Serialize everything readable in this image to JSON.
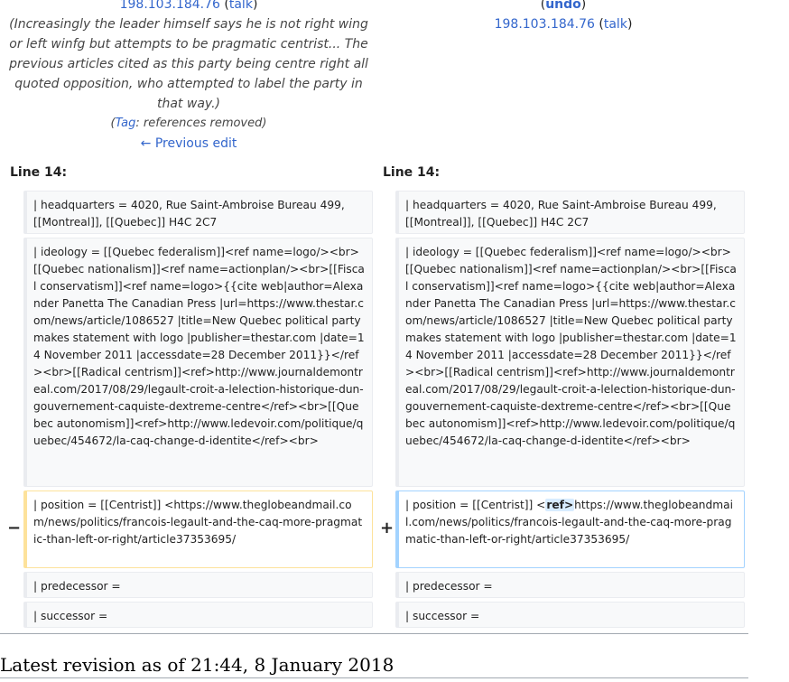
{
  "left_header": {
    "ip": "198.103.184.76",
    "talk": "talk",
    "comment": "(Increasingly the leader himself says he is not right wing or left winfg but attempts to be pragmatic centrist... The previous articles cited as this party being centre right all quoted opposition, who attempted to label the party in that way.)",
    "tag_label": "Tag",
    "tag_value": "references removed",
    "prev_edit": "← Previous edit"
  },
  "right_header": {
    "undo": "undo",
    "ip": "198.103.184.76",
    "talk": "talk"
  },
  "diff": {
    "left_line": "Line 14:",
    "right_line": "Line 14:",
    "marker_minus": "−",
    "marker_plus": "+",
    "rows": {
      "hq": "| headquarters = 4020, Rue Saint-Ambroise Bureau 499, [[Montreal]], [[Quebec]] H4C 2C7",
      "ideology": "| ideology = [[Quebec federalism]]<ref name=logo/><br>[[Quebec nationalism]]<ref name=actionplan/><br>[[Fiscal conservatism]]<ref name=logo>{{cite web|author=Alexander Panetta The Canadian Press |url=https://www.thestar.com/news/article/1086527 |title=New Quebec political party makes statement with logo |publisher=thestar.com |date=14 November 2011 |accessdate=28 December 2011}}</ref><br>[[Radical centrism]]<ref>http://www.journaldemontreal.com/2017/08/29/legault-croit-a-lelection-historique-dun-gouvernement-caquiste-dextreme-centre</ref><br>[[Quebec autonomism]]<ref>http://www.ledevoir.com/politique/quebec/454672/la-caq-change-d-identite</ref><br>",
      "position_old": "| position = [[Centrist]] <https://www.theglobeandmail.com/news/politics/francois-legault-and-the-caq-more-pragmatic-than-left-or-right/article37353695/",
      "position_new_pre": "| position = [[Centrist]] <",
      "position_new_ins": "ref>",
      "position_new_post": "https://www.theglobeandmail.com/news/politics/francois-legault-and-the-caq-more-pragmatic-than-left-or-right/article37353695/",
      "predecessor": "| predecessor =",
      "successor": "| successor ="
    }
  },
  "latest_revision": "Latest revision as of 21:44, 8 January 2018"
}
